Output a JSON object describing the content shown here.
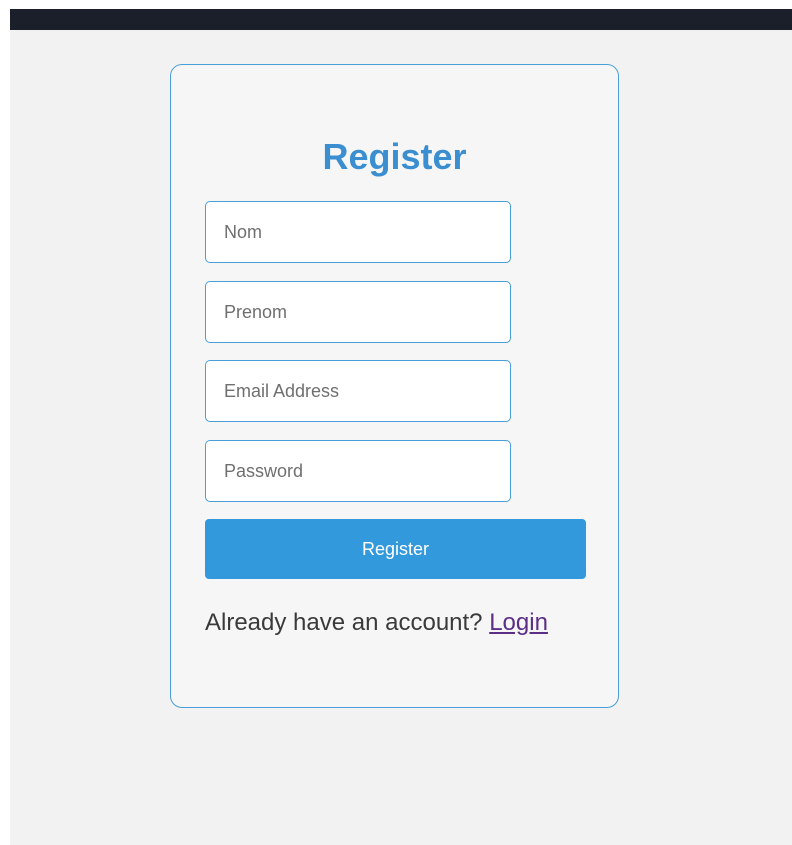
{
  "register_form": {
    "title": "Register",
    "fields": [
      {
        "placeholder": "Nom",
        "value": ""
      },
      {
        "placeholder": "Prenom",
        "value": ""
      },
      {
        "placeholder": "Email Address",
        "value": ""
      },
      {
        "placeholder": "Password",
        "value": ""
      }
    ],
    "submit_label": "Register",
    "footer_prompt": "Already have an account?",
    "login_link": "Login"
  },
  "colors": {
    "accent": "#3399dd",
    "title": "#3b8fd0",
    "border": "#4a9fd6",
    "top_bar": "#1b1f2a",
    "link": "#5b2f86"
  }
}
